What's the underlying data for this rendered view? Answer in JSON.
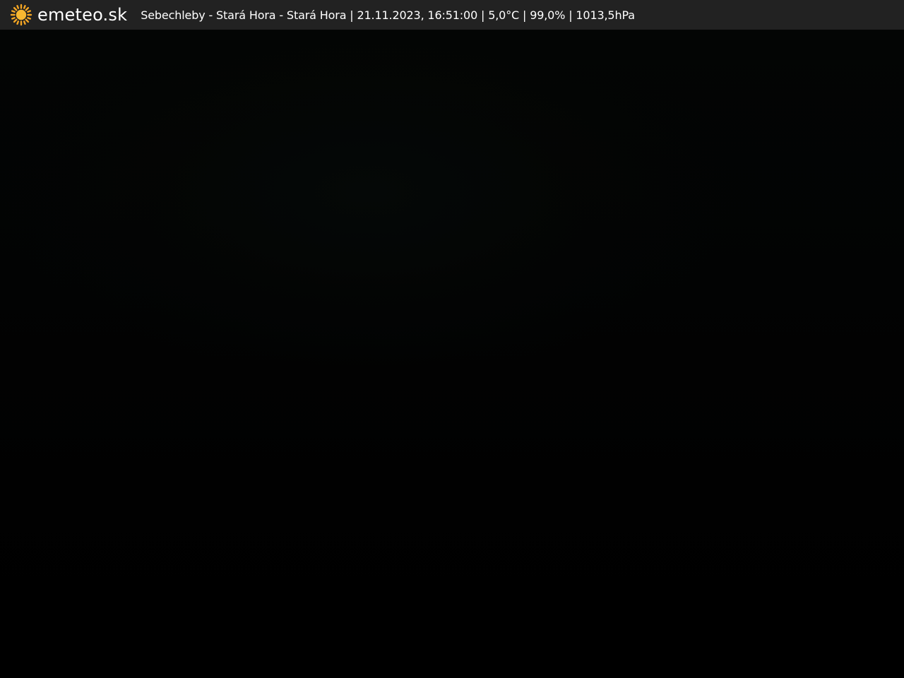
{
  "header": {
    "logo": {
      "icon": "sun-icon",
      "text": "emeteo.sk",
      "sun_color": "#f5a623"
    },
    "caption": "Sebechleby - Stará Hora - Stará Hora | 21.11.2023, 16:51:00 | 5,0°C | 99,0% | 1013,5hPa",
    "background": "#222222"
  },
  "webcam": {
    "background": "#010101"
  }
}
